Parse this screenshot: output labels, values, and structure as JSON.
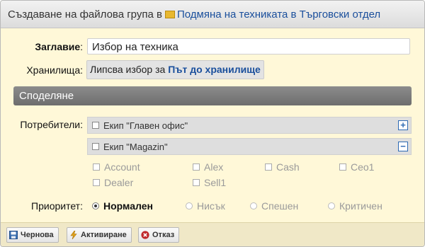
{
  "title": {
    "prefix": "Създаване на файлова група в",
    "folder_icon": "folder-icon",
    "project": "Подмяна на техниката в Търговски отдел"
  },
  "form": {
    "title_label": "Заглавие",
    "title_colon": ":",
    "title_value": "Избор на техника",
    "storage_label": "Хранилища:",
    "storage_text": "Липсва избор за",
    "storage_link": "Път до хранилище"
  },
  "sharing": {
    "section_title": "Споделяне",
    "users_label": "Потребители:",
    "groups": [
      {
        "name": "Екип \"Главен офис\"",
        "toggle": "+"
      },
      {
        "name": "Екип \"Magazin\"",
        "toggle": "−"
      }
    ],
    "members": [
      "Account",
      "Alex",
      "Cash",
      "Ceo1",
      "Dealer",
      "Sell1"
    ]
  },
  "priority": {
    "label": "Приоритет:",
    "options": [
      "Нормален",
      "Нисък",
      "Спешен",
      "Критичен"
    ],
    "selected": "Нормален"
  },
  "footer": {
    "draft": "Чернова",
    "activate": "Активиране",
    "cancel": "Отказ"
  },
  "colors": {
    "background": "#fff8d8",
    "link": "#1a4f9c",
    "section_header": "#7a7a7a",
    "cancel_icon": "#c0282b",
    "activate_icon": "#e1a21b"
  }
}
